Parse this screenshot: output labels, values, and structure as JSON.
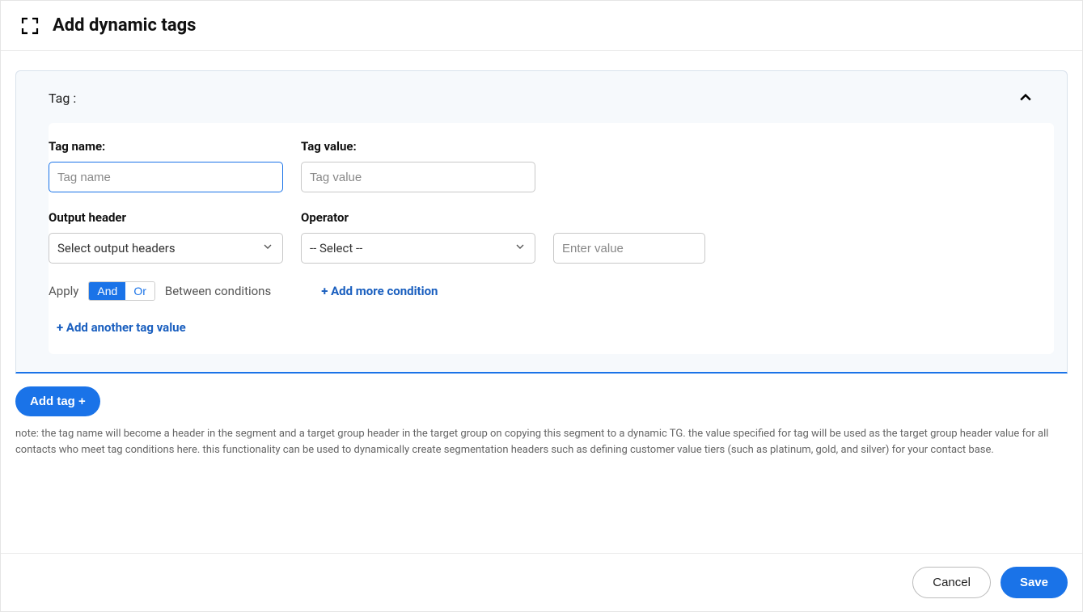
{
  "header": {
    "title": "Add dynamic tags"
  },
  "panel": {
    "label": "Tag :",
    "tag_name_label": "Tag name:",
    "tag_name_placeholder": "Tag name",
    "tag_value_label": "Tag value:",
    "tag_value_placeholder": "Tag value",
    "output_header_label": "Output header",
    "output_header_selected": "Select output headers",
    "operator_label": "Operator",
    "operator_selected": "-- Select --",
    "value_placeholder": "Enter value",
    "apply_label": "Apply",
    "and_label": "And",
    "or_label": "Or",
    "between_label": "Between conditions",
    "add_more_condition": "+ Add more condition",
    "add_another_tag_value": "+ Add another tag value"
  },
  "actions": {
    "add_tag": "Add tag +",
    "cancel": "Cancel",
    "save": "Save"
  },
  "note": "note: the tag name will become a header in the segment and a target group header in the target group on copying this segment to a dynamic TG. the value specified for tag will be used as the target group header value for all contacts who meet tag conditions here. this functionality can be used to dynamically create segmentation headers such as defining customer value tiers (such as platinum, gold, and silver) for your contact base."
}
